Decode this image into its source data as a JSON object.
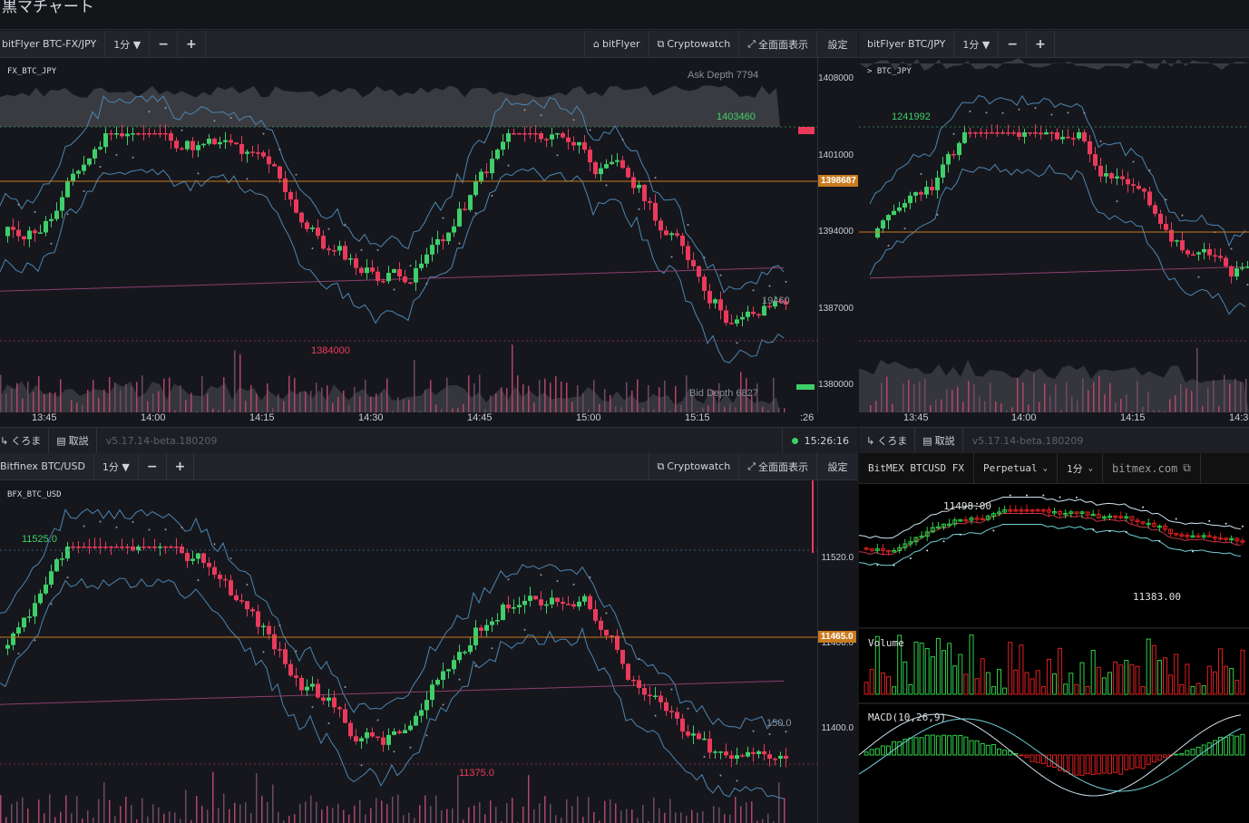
{
  "app_title": "黒マチャート",
  "panel1": {
    "exchange": "bitFlyer BTC-FX/JPY",
    "interval": "1分 ▼",
    "minus": "−",
    "plus": "+",
    "link_bitflyer": "bitFlyer",
    "link_cryptowatch": "Cryptowatch",
    "fullscreen": "全面面表示",
    "settings": "設定",
    "symbol": "FX_BTC_JPY",
    "y_ticks": [
      "1408000",
      "1401000",
      "1394000",
      "1387000",
      "1380000"
    ],
    "x_ticks": [
      "13:45",
      "14:00",
      "14:15",
      "14:30",
      "14:45",
      "15:00",
      "15:15",
      ":26"
    ],
    "ask_depth": "Ask Depth 7794",
    "bid_depth": "Bid Depth 6827",
    "high_label": "1403460",
    "low_label": "1384000",
    "last_price": "1398687",
    "volume_label": "19460"
  },
  "panel2": {
    "exchange": "bitFlyer BTC/JPY",
    "interval": "1分 ▼",
    "minus": "−",
    "plus": "+",
    "symbol": "> BTC_JPY",
    "high_label": "1241992",
    "x_ticks": [
      "13:45",
      "14:00",
      "14:15",
      "14:3"
    ]
  },
  "status1": {
    "kuroma": "くろま",
    "torisetsu": "取説",
    "version": "v5.17.14-beta.180209",
    "time": "15:26:16"
  },
  "status2": {
    "kuroma": "くろま",
    "torisetsu": "取説",
    "version": "v5.17.14-beta.180209"
  },
  "panel3": {
    "exchange": "Bitfinex BTC/USD",
    "interval": "1分 ▼",
    "minus": "−",
    "plus": "+",
    "link_cryptowatch": "Cryptowatch",
    "fullscreen": "全面面表示",
    "settings": "設定",
    "symbol": "BFX_BTC_USD",
    "y_ticks": [
      "11520.0",
      "11460.0",
      "11400.0"
    ],
    "high_label": "11525.0",
    "low_label": "11375.0",
    "last_price": "11465.0",
    "volume_label": "150.0"
  },
  "panel4": {
    "exchange": "BitMEX BTCUSD FX",
    "contract": "Perpetual",
    "interval": "1分",
    "site": "bitmex.com",
    "high_label": "11498.00",
    "low_label": "11383.00",
    "volume_title": "Volume",
    "macd_title": "MACD(10,26,9)"
  },
  "colors": {
    "up": "#3fcf6a",
    "down": "#ea3a5c",
    "orange": "#c97a1f",
    "bollinger": "#4b86b4",
    "ma": "#8a3f6e"
  }
}
